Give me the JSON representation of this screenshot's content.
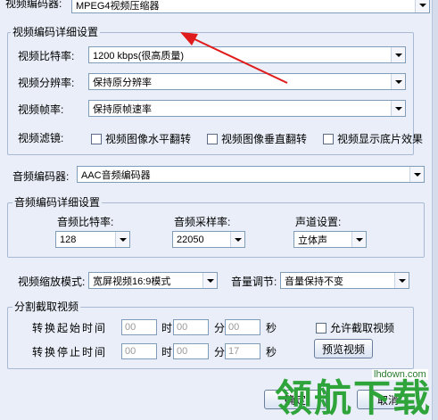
{
  "video": {
    "encoder_label": "视频编码器:",
    "encoder_value": "MPEG4视频压缩器",
    "details_title": "视频编码详细设置",
    "bitrate_label": "视频比特率:",
    "bitrate_value": "1200 kbps(很高质量)",
    "resolution_label": "视频分辨率:",
    "resolution_value": "保持原分辨率",
    "framerate_label": "视频帧率:",
    "framerate_value": "保持原帧速率",
    "filter_label": "视频滤镜:",
    "filter_hflip": "视频图像水平翻转",
    "filter_vflip": "视频图像垂直翻转",
    "filter_negative": "视频显示底片效果"
  },
  "audio": {
    "encoder_label": "音频编码器:",
    "encoder_value": "AAC音频编码器",
    "details_title": "音频编码详细设置",
    "bitrate_label": "音频比特率:",
    "bitrate_value": "128",
    "samplerate_label": "音频采样率:",
    "samplerate_value": "22050",
    "channel_label": "声道设置:",
    "channel_value": "立体声"
  },
  "scale": {
    "mode_label": "视频缩放模式:",
    "mode_value": "宽屏视频16:9模式",
    "volume_label": "音量调节:",
    "volume_value": "音量保持不变"
  },
  "clip": {
    "title": "分割截取视频",
    "start_label": "转换起始时间",
    "end_label": "转换停止时间",
    "start_h": "00",
    "start_m": "00",
    "start_s": "00",
    "end_h": "00",
    "end_m": "00",
    "end_s": "17",
    "unit_h": "时",
    "unit_m": "分",
    "unit_s": "秒",
    "allow_clip": "允许截取视频",
    "preview_button": "预览视频"
  },
  "footer": {
    "ok_button": "确定",
    "cancel_button": "取消"
  },
  "watermark": {
    "text": "领航下载",
    "url": "lhdown.com"
  },
  "colors": {
    "background": "#e9eef8",
    "annotation_arrow": "#e01b1b",
    "watermark": "#2ea43a"
  }
}
